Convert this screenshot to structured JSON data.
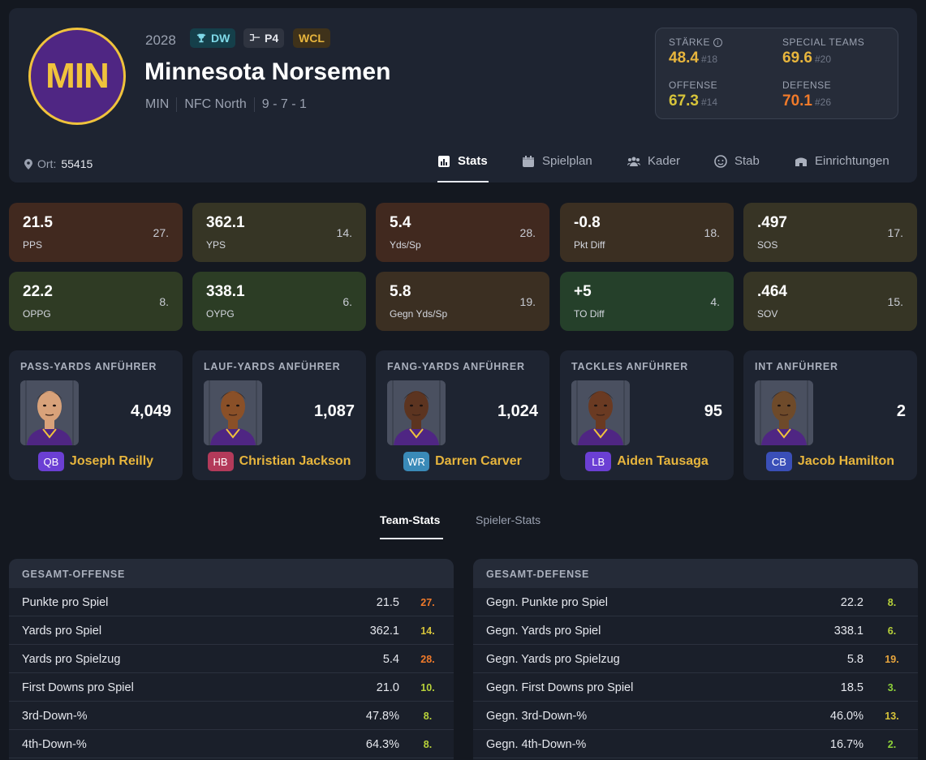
{
  "header": {
    "logo_text": "MIN",
    "year": "2028",
    "badges": [
      "DW",
      "P4",
      "WCL"
    ],
    "team_name": "Minnesota Norsemen",
    "abbr": "MIN",
    "division": "NFC North",
    "record": "9 - 7 - 1",
    "location_label": "Ort:",
    "location_value": "55415"
  },
  "ratings": {
    "staerke": {
      "label": "STÄRKE",
      "value": "48.4",
      "rank": "#18",
      "color": "#e7b53d"
    },
    "special": {
      "label": "SPECIAL TEAMS",
      "value": "69.6",
      "rank": "#20",
      "color": "#e7b53d"
    },
    "offense": {
      "label": "OFFENSE",
      "value": "67.3",
      "rank": "#14",
      "color": "#d7c43a"
    },
    "defense": {
      "label": "DEFENSE",
      "value": "70.1",
      "rank": "#26",
      "color": "#f07a2a"
    }
  },
  "tabs": [
    "Stats",
    "Spielplan",
    "Kader",
    "Stab",
    "Einrichtungen"
  ],
  "stats_top": [
    {
      "value": "21.5",
      "label": "PPS",
      "rank": "27.",
      "bg": "#41291f"
    },
    {
      "value": "362.1",
      "label": "YPS",
      "rank": "14.",
      "bg": "#363525"
    },
    {
      "value": "5.4",
      "label": "Yds/Sp",
      "rank": "28.",
      "bg": "#41291f"
    },
    {
      "value": "-0.8",
      "label": "Pkt Diff",
      "rank": "18.",
      "bg": "#3b2f22"
    },
    {
      "value": ".497",
      "label": "SOS",
      "rank": "17.",
      "bg": "#373425"
    }
  ],
  "stats_bottom": [
    {
      "value": "22.2",
      "label": "OPPG",
      "rank": "8.",
      "bg": "#2f3b24"
    },
    {
      "value": "338.1",
      "label": "OYPG",
      "rank": "6.",
      "bg": "#2c3d25"
    },
    {
      "value": "5.8",
      "label": "Gegn Yds/Sp",
      "rank": "19.",
      "bg": "#3b2f22"
    },
    {
      "value": "+5",
      "label": "TO Diff",
      "rank": "4.",
      "bg": "#25402a"
    },
    {
      "value": ".464",
      "label": "SOV",
      "rank": "15.",
      "bg": "#363525"
    }
  ],
  "leaders": [
    {
      "title": "PASS-YARDS ANFÜHRER",
      "value": "4,049",
      "pos": "QB",
      "pos_color": "#6b3fd4",
      "name": "Joseph Reilly",
      "skin": "#d8a27a"
    },
    {
      "title": "LAUF-YARDS ANFÜHRER",
      "value": "1,087",
      "pos": "HB",
      "pos_color": "#b33a5a",
      "name": "Christian Jackson",
      "skin": "#8a5028"
    },
    {
      "title": "FANG-YARDS ANFÜHRER",
      "value": "1,024",
      "pos": "WR",
      "pos_color": "#3a8ab8",
      "name": "Darren Carver",
      "skin": "#5c3420"
    },
    {
      "title": "TACKLES ANFÜHRER",
      "value": "95",
      "pos": "LB",
      "pos_color": "#6b3fd4",
      "name": "Aiden Tausaga",
      "skin": "#6a3a22"
    },
    {
      "title": "INT ANFÜHRER",
      "value": "2",
      "pos": "CB",
      "pos_color": "#3a4fb8",
      "name": "Jacob Hamilton",
      "skin": "#6e4a2a"
    }
  ],
  "subtabs": [
    "Team-Stats",
    "Spieler-Stats"
  ],
  "offense_table": {
    "title": "GESAMT-OFFENSE",
    "rows": [
      {
        "name": "Punkte pro Spiel",
        "value": "21.5",
        "rank": "27.",
        "color": "#f07a2a"
      },
      {
        "name": "Yards pro Spiel",
        "value": "362.1",
        "rank": "14.",
        "color": "#d7c43a"
      },
      {
        "name": "Yards pro Spielzug",
        "value": "5.4",
        "rank": "28.",
        "color": "#f07a2a"
      },
      {
        "name": "First Downs pro Spiel",
        "value": "21.0",
        "rank": "10.",
        "color": "#b8d23a"
      },
      {
        "name": "3rd-Down-%",
        "value": "47.8%",
        "rank": "8.",
        "color": "#b8d23a"
      },
      {
        "name": "4th-Down-%",
        "value": "64.3%",
        "rank": "8.",
        "color": "#b8d23a"
      }
    ]
  },
  "defense_table": {
    "title": "GESAMT-DEFENSE",
    "rows": [
      {
        "name": "Gegn. Punkte pro Spiel",
        "value": "22.2",
        "rank": "8.",
        "color": "#b8d23a"
      },
      {
        "name": "Gegn. Yards pro Spiel",
        "value": "338.1",
        "rank": "6.",
        "color": "#b8d23a"
      },
      {
        "name": "Gegn. Yards pro Spielzug",
        "value": "5.8",
        "rank": "19.",
        "color": "#e7a53d"
      },
      {
        "name": "Gegn. First Downs pro Spiel",
        "value": "18.5",
        "rank": "3.",
        "color": "#8ed23a"
      },
      {
        "name": "Gegn. 3rd-Down-%",
        "value": "46.0%",
        "rank": "13.",
        "color": "#d7c43a"
      },
      {
        "name": "Gegn. 4th-Down-%",
        "value": "16.7%",
        "rank": "2.",
        "color": "#8ed23a"
      }
    ]
  }
}
